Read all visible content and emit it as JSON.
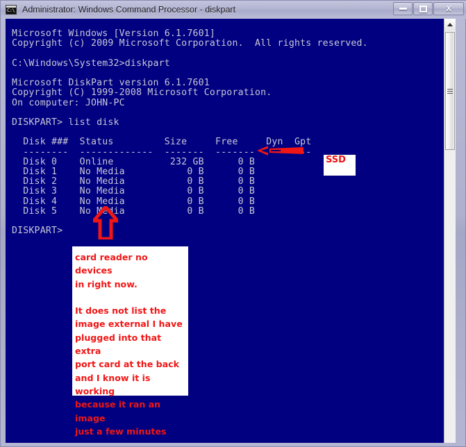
{
  "window": {
    "title": "Administrator: Windows Command Processor - diskpart",
    "icon": "cmd-console-icon",
    "prompt_glyph": "C:\\",
    "controls": {
      "minimize_label": "Minimize",
      "maximize_label": "Maximize",
      "close_label": "X"
    }
  },
  "console": {
    "background_color": "#000080",
    "text_color": "#c8c8d8",
    "lines": [
      "Microsoft Windows [Version 6.1.7601]",
      "Copyright (c) 2009 Microsoft Corporation.  All rights reserved.",
      "",
      "C:\\Windows\\System32>diskpart",
      "",
      "Microsoft DiskPart version 6.1.7601",
      "Copyright (C) 1999-2008 Microsoft Corporation.",
      "On computer: JOHN-PC",
      "",
      "DISKPART> list disk",
      "",
      "  Disk ###  Status         Size     Free     Dyn  Gpt",
      "  --------  -------------  -------  -------  ---  ---",
      "  Disk 0    Online          232 GB      0 B",
      "  Disk 1    No Media           0 B      0 B",
      "  Disk 2    No Media           0 B      0 B",
      "  Disk 3    No Media           0 B      0 B",
      "  Disk 4    No Media           0 B      0 B",
      "  Disk 5    No Media           0 B      0 B",
      "",
      "DISKPART>"
    ],
    "text": "Microsoft Windows [Version 6.1.7601]\nCopyright (c) 2009 Microsoft Corporation.  All rights reserved.\n\nC:\\Windows\\System32>diskpart\n\nMicrosoft DiskPart version 6.1.7601\nCopyright (C) 1999-2008 Microsoft Corporation.\nOn computer: JOHN-PC\n\nDISKPART> list disk\n\n  Disk ###  Status         Size     Free     Dyn  Gpt\n  --------  -------------  -------  -------  ---  ---\n  Disk 0    Online          232 GB      0 B\n  Disk 1    No Media           0 B      0 B\n  Disk 2    No Media           0 B      0 B\n  Disk 3    No Media           0 B      0 B\n  Disk 4    No Media           0 B      0 B\n  Disk 5    No Media           0 B      0 B\n\nDISKPART>",
    "disk_table": {
      "columns": [
        "Disk ###",
        "Status",
        "Size",
        "Free",
        "Dyn",
        "Gpt"
      ],
      "rows": [
        {
          "disk": "Disk 0",
          "status": "Online",
          "size": "232 GB",
          "free": "0 B",
          "dyn": "",
          "gpt": ""
        },
        {
          "disk": "Disk 1",
          "status": "No Media",
          "size": "0 B",
          "free": "0 B",
          "dyn": "",
          "gpt": ""
        },
        {
          "disk": "Disk 2",
          "status": "No Media",
          "size": "0 B",
          "free": "0 B",
          "dyn": "",
          "gpt": ""
        },
        {
          "disk": "Disk 3",
          "status": "No Media",
          "size": "0 B",
          "free": "0 B",
          "dyn": "",
          "gpt": ""
        },
        {
          "disk": "Disk 4",
          "status": "No Media",
          "size": "0 B",
          "free": "0 B",
          "dyn": "",
          "gpt": ""
        },
        {
          "disk": "Disk 5",
          "status": "No Media",
          "size": "0 B",
          "free": "0 B",
          "dyn": "",
          "gpt": ""
        }
      ]
    }
  },
  "annotations": {
    "color": "#f01616",
    "ssd_label": "SSD",
    "note": "card reader no devices\nin right now.\n\nIt does not list the\nimage external I have\nplugged into that extra\nport card at the back\nand I know it is working\nbecause it ran an image\njust a few minutes ago",
    "arrow_left_name": "points to Disk 0 free column",
    "arrow_up_name": "points to card reader disk rows"
  },
  "scrollbar": {
    "up_arrow": "scroll-up",
    "thumb": "scroll-thumb"
  }
}
